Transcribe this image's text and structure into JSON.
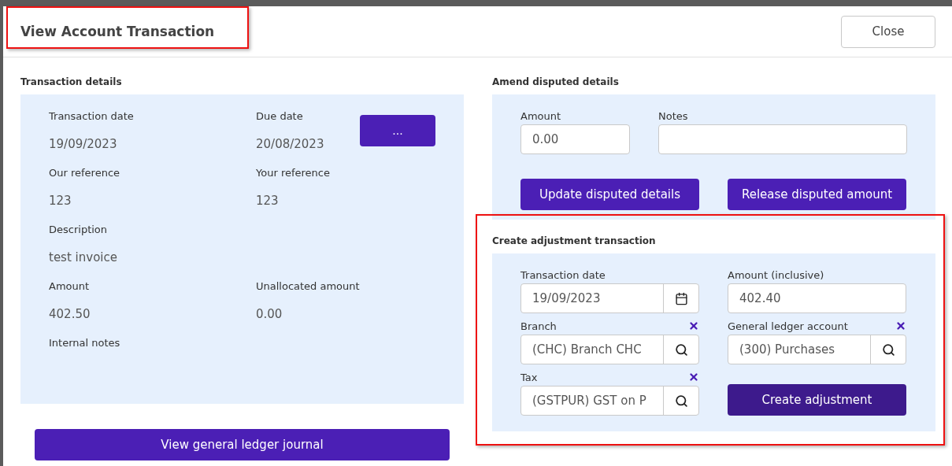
{
  "window": {
    "title": "View Account Transaction",
    "highlighted": true,
    "close_button": "Close"
  },
  "transaction_details": {
    "title": "Transaction details",
    "more_button": "...",
    "rows": [
      [
        {
          "label": "Transaction date",
          "value": "19/09/2023"
        },
        {
          "label": "Due date",
          "value": "20/08/2023"
        }
      ],
      [
        {
          "label": "Our reference",
          "value": "123"
        },
        {
          "label": "Your reference",
          "value": "123"
        }
      ],
      [
        {
          "label": "Description",
          "value": "test invoice"
        }
      ],
      [
        {
          "label": "Amount",
          "value": "402.50"
        },
        {
          "label": "Unallocated amount",
          "value": "0.00"
        }
      ],
      [
        {
          "label": "Internal notes"
        }
      ]
    ],
    "journal_button": "View general ledger journal"
  },
  "amend_disputed": {
    "title": "Amend disputed details",
    "amount": {
      "label": "Amount",
      "value": "0.00"
    },
    "notes": {
      "label": "Notes"
    },
    "buttons": [
      "Update disputed details",
      "Release disputed amount"
    ]
  },
  "create_adjustment": {
    "title": "Create adjustment transaction",
    "highlighted": true,
    "fields": [
      {
        "kind": "date",
        "label": "Transaction date",
        "value": "19/09/2023",
        "clearable": false
      },
      {
        "kind": "text",
        "label": "Amount (inclusive)",
        "value": "402.40",
        "clearable": false
      },
      {
        "kind": "lookup",
        "label": "Branch",
        "value": "(CHC) Branch CHC",
        "clearable": true
      },
      {
        "kind": "lookup",
        "label": "General ledger account",
        "value": "(300) Purchases",
        "clearable": true
      },
      {
        "kind": "lookup",
        "label": "Tax",
        "value": "(GSTPUR) GST on P",
        "clearable": true
      }
    ],
    "button": "Create adjustment"
  }
}
